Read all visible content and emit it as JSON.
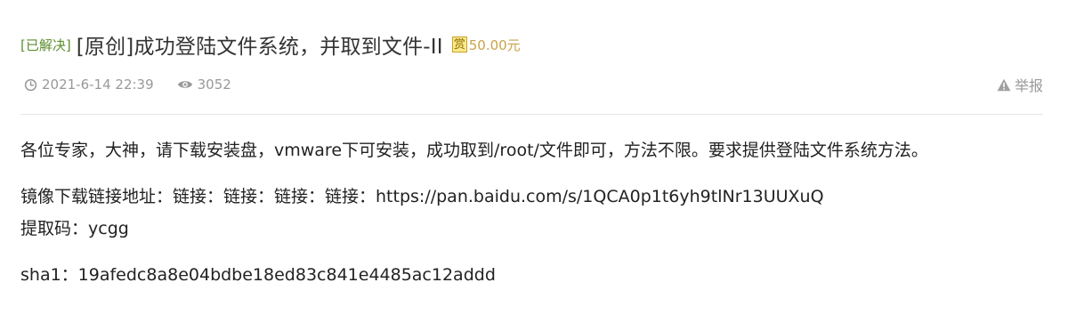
{
  "post": {
    "status_tag": "[已解决]",
    "title": "[原创]成功登陆文件系统，并取到文件-II",
    "reward": {
      "icon": "reward-badge-icon",
      "icon_char": "赏",
      "amount": "50.00元"
    },
    "meta": {
      "date": "2021-6-14 22:39",
      "views": "3052"
    },
    "report_label": "举报",
    "body": {
      "para1": "各位专家，大神，请下载安装盘，vmware下可安装，成功取到/root/文件即可，方法不限。要求提供登陆文件系统方法。",
      "download_prefix": "镜像下载链接地址：链接：链接：链接：链接：",
      "download_url": "https://pan.baidu.com/s/1QCA0p1t6yh9tlNr13UUXuQ",
      "extract_code": "提取码：ycgg",
      "sha1": "sha1：19afedc8a8e04bdbe18ed83c841e4485ac12addd"
    }
  },
  "colors": {
    "solved": "#5b8e2d",
    "reward": "#c9a24a",
    "meta": "#999999",
    "text": "#222222"
  }
}
